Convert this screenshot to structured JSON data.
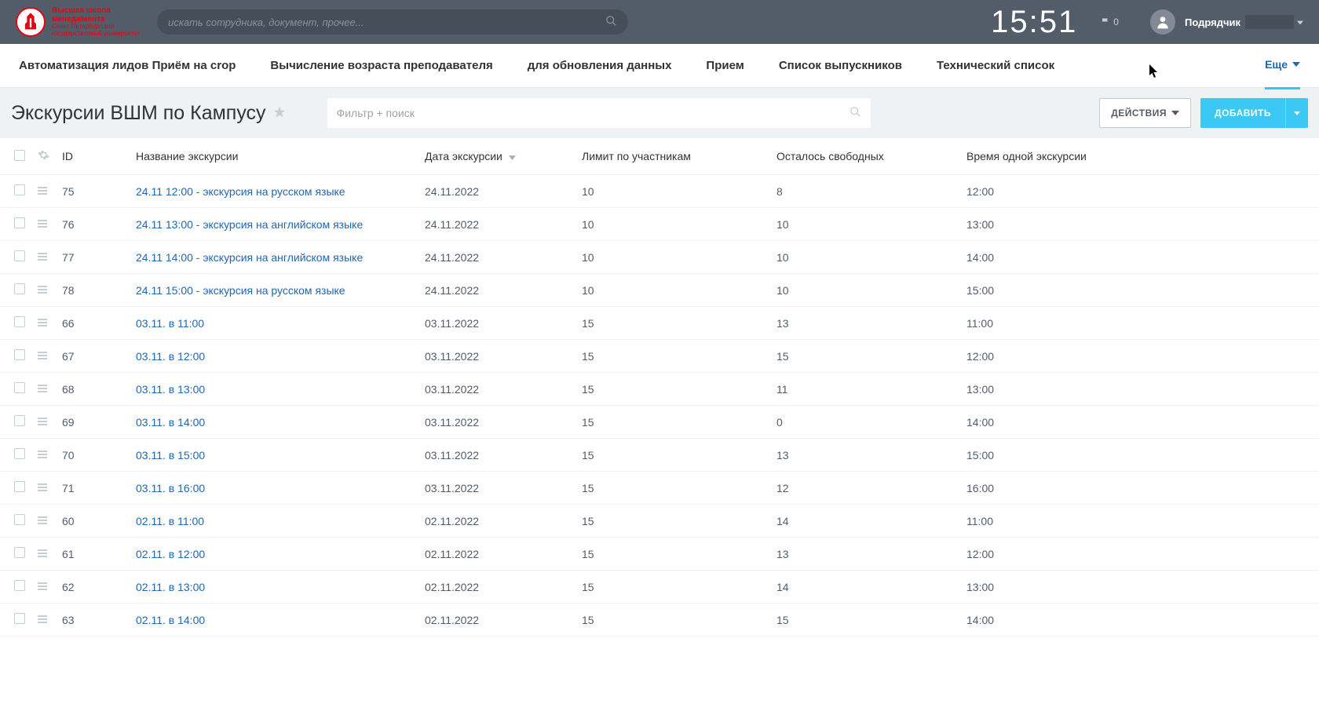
{
  "header": {
    "search_placeholder": "искать сотрудника, документ, прочее...",
    "clock": "15:51",
    "flag_count": "0",
    "user_role": "Подрядчик",
    "logo_line1": "Высшая школа",
    "logo_line2": "менеджмента",
    "logo_line3": "Санкт-Петербургский государственный университет"
  },
  "nav": {
    "items": [
      "Автоматизация лидов Приём на crop",
      "Вычисление возраста преподавателя",
      "для обновления данных",
      "Прием",
      "Список выпускников",
      "Технический список"
    ],
    "more": "Еще"
  },
  "titlebar": {
    "title": "Экскурсии ВШМ по Кампусу",
    "filter_placeholder": "Фильтр + поиск",
    "actions_label": "ДЕЙСТВИЯ",
    "add_label": "ДОБАВИТЬ"
  },
  "table": {
    "columns": {
      "id": "ID",
      "name": "Название экскурсии",
      "date": "Дата экскурсии",
      "limit": "Лимит по участникам",
      "free": "Осталось свободных",
      "time": "Время одной экскурсии"
    },
    "rows": [
      {
        "id": "75",
        "name": "24.11 12:00 - экскурсия на русском языке",
        "date": "24.11.2022",
        "limit": "10",
        "free": "8",
        "time": "12:00"
      },
      {
        "id": "76",
        "name": "24.11 13:00 - экскурсия на английском языке",
        "date": "24.11.2022",
        "limit": "10",
        "free": "10",
        "time": "13:00"
      },
      {
        "id": "77",
        "name": "24.11 14:00 - экскурсия на английском языке",
        "date": "24.11.2022",
        "limit": "10",
        "free": "10",
        "time": "14:00"
      },
      {
        "id": "78",
        "name": "24.11 15:00 - экскурсия на русском языке",
        "date": "24.11.2022",
        "limit": "10",
        "free": "10",
        "time": "15:00"
      },
      {
        "id": "66",
        "name": "03.11. в 11:00",
        "date": "03.11.2022",
        "limit": "15",
        "free": "13",
        "time": "11:00"
      },
      {
        "id": "67",
        "name": "03.11. в 12:00",
        "date": "03.11.2022",
        "limit": "15",
        "free": "15",
        "time": "12:00"
      },
      {
        "id": "68",
        "name": "03.11. в 13:00",
        "date": "03.11.2022",
        "limit": "15",
        "free": "11",
        "time": "13:00"
      },
      {
        "id": "69",
        "name": "03.11. в 14:00",
        "date": "03.11.2022",
        "limit": "15",
        "free": "0",
        "time": "14:00"
      },
      {
        "id": "70",
        "name": "03.11. в 15:00",
        "date": "03.11.2022",
        "limit": "15",
        "free": "13",
        "time": "15:00"
      },
      {
        "id": "71",
        "name": "03.11. в 16:00",
        "date": "03.11.2022",
        "limit": "15",
        "free": "12",
        "time": "16:00"
      },
      {
        "id": "60",
        "name": "02.11. в 11:00",
        "date": "02.11.2022",
        "limit": "15",
        "free": "14",
        "time": "11:00"
      },
      {
        "id": "61",
        "name": "02.11. в 12:00",
        "date": "02.11.2022",
        "limit": "15",
        "free": "13",
        "time": "12:00"
      },
      {
        "id": "62",
        "name": "02.11. в 13:00",
        "date": "02.11.2022",
        "limit": "15",
        "free": "14",
        "time": "13:00"
      },
      {
        "id": "63",
        "name": "02.11. в 14:00",
        "date": "02.11.2022",
        "limit": "15",
        "free": "15",
        "time": "14:00"
      }
    ]
  }
}
